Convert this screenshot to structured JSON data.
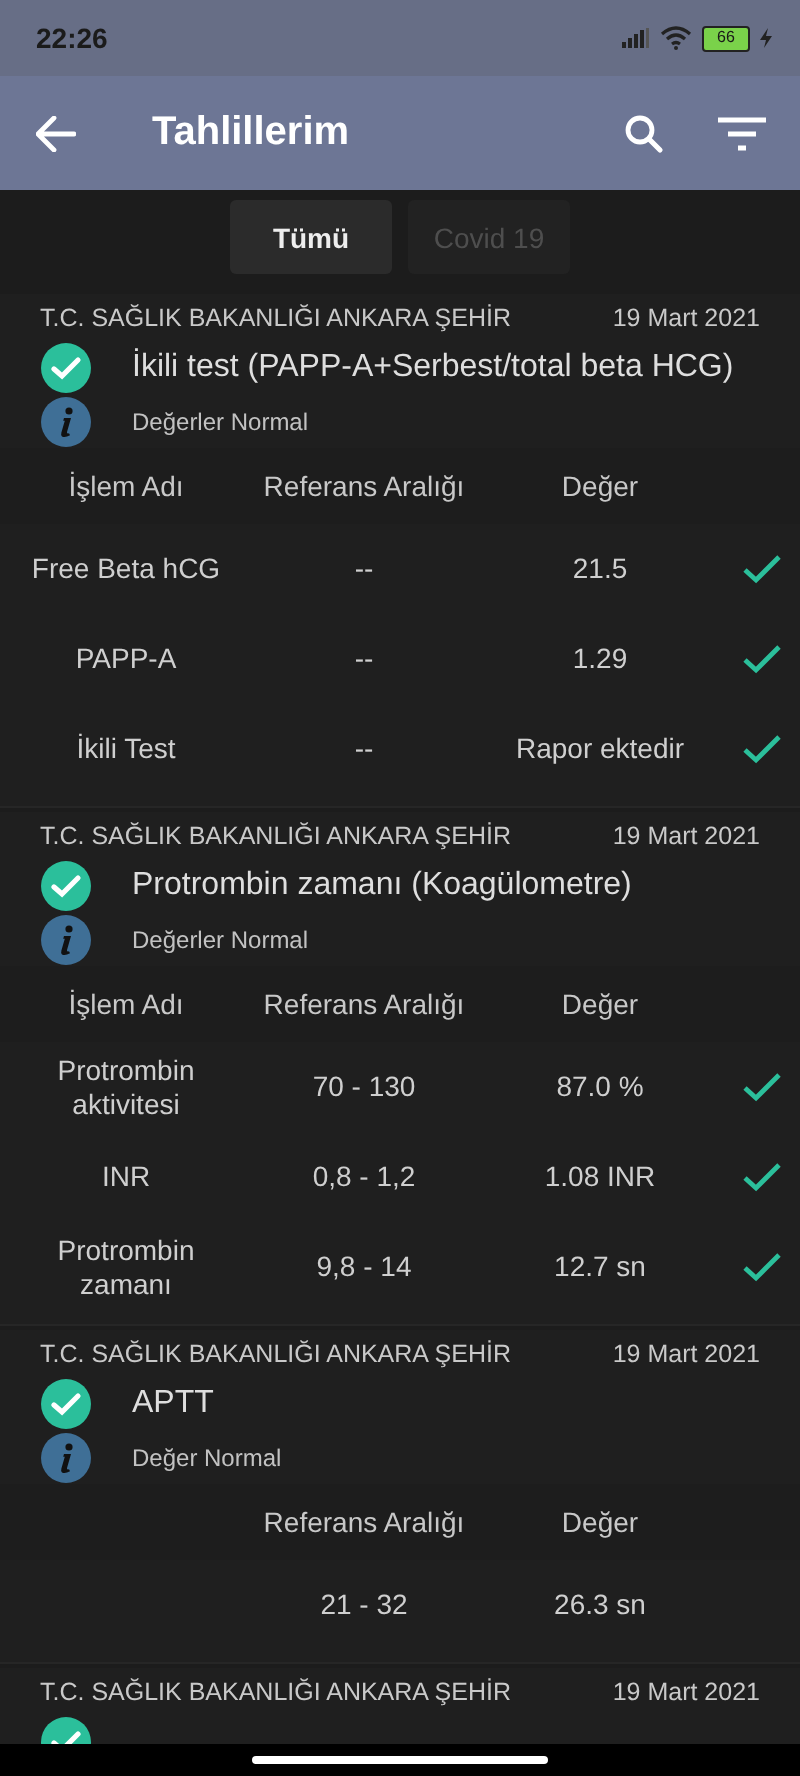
{
  "status_bar": {
    "time": "22:26",
    "battery": "66"
  },
  "app_bar": {
    "title": "Tahlillerim"
  },
  "tabs": [
    {
      "label": "Tümü",
      "selected": true
    },
    {
      "label": "Covid 19",
      "selected": false
    }
  ],
  "cards": [
    {
      "lab": "T.C. SAĞLIK BAKANLIĞI ANKARA ŞEHİR",
      "date": "19 Mart 2021",
      "normal": true,
      "title": "İkili test (PAPP-A+Serbest/total beta HCG)",
      "status_text": "Değerler Normal",
      "header": {
        "name": "İşlem Adı",
        "range": "Referans Aralığı",
        "value": "Değer"
      },
      "rows": [
        {
          "name": "Free Beta hCG",
          "range": "--",
          "value": "21.5",
          "checked": true
        },
        {
          "name": "PAPP-A",
          "range": "--",
          "value": "1.29",
          "checked": true
        },
        {
          "name": "İkili Test",
          "range": "--",
          "value": "Rapor ektedir",
          "checked": true
        }
      ]
    },
    {
      "lab": "T.C. SAĞLIK BAKANLIĞI ANKARA ŞEHİR",
      "date": "19 Mart 2021",
      "normal": true,
      "title": "Protrombin zamanı (Koagülometre)",
      "status_text": "Değerler Normal",
      "header": {
        "name": "İşlem Adı",
        "range": "Referans Aralığı",
        "value": "Değer"
      },
      "rows": [
        {
          "name": "Protrombin aktivitesi",
          "range": "70 - 130",
          "value": "87.0 %",
          "checked": true
        },
        {
          "name": "INR",
          "range": "0,8 - 1,2",
          "value": "1.08 INR",
          "checked": true
        },
        {
          "name": "Protrombin zamanı",
          "range": "9,8 - 14",
          "value": "12.7 sn",
          "checked": true
        }
      ]
    },
    {
      "lab": "T.C. SAĞLIK BAKANLIĞI ANKARA ŞEHİR",
      "date": "19 Mart 2021",
      "normal": true,
      "title": "APTT",
      "status_text": "Değer Normal",
      "header": {
        "range": "Referans Aralığı",
        "value": "Değer"
      },
      "rows": [
        {
          "range": "21 - 32",
          "value": "26.3 sn",
          "checked": false
        }
      ]
    },
    {
      "lab": "T.C. SAĞLIK BAKANLIĞI ANKARA ŞEHİR",
      "date": "19 Mart 2021",
      "normal": true
    }
  ]
}
